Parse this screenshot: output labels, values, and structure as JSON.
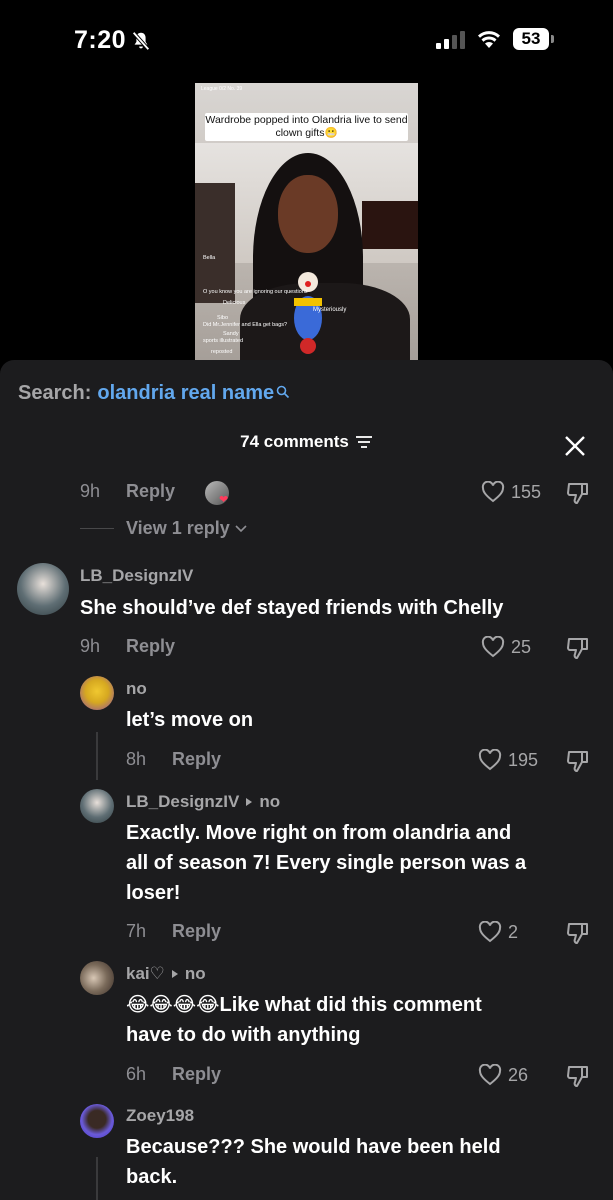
{
  "status": {
    "time": "7:20",
    "battery": "53"
  },
  "video": {
    "caption": "Wardrobe popped into Olandria live to send clown gifts😬",
    "top_text": "League 0/2 No. 39",
    "chat": [
      "Bella",
      "O you know you are ignoring our questions",
      "Delicious",
      "Sibo",
      "Did Mr.Jennifer and Ella get bags?",
      "Sandy",
      "sports illustrated",
      "reposted"
    ],
    "gift_label": "Mysteriously"
  },
  "search": {
    "label": "Search:",
    "query": "olandria real name"
  },
  "header": {
    "count": "74 comments"
  },
  "comments": [
    {
      "id": "c0",
      "time": "9h",
      "reply": "Reply",
      "likes": "155",
      "view_replies": "View 1 reply"
    },
    {
      "id": "c1",
      "user": "LB_DesignzIV",
      "text": "She should’ve def stayed friends with Chelly",
      "time": "9h",
      "reply": "Reply",
      "likes": "25"
    },
    {
      "id": "c2",
      "user": "no",
      "text": "let’s move on",
      "time": "8h",
      "reply": "Reply",
      "likes": "195"
    },
    {
      "id": "c3",
      "user": "LB_DesignzIV",
      "reply_to": "no",
      "text_lines": [
        "Exactly. Move right on from olandria and",
        "all of season 7! Every single person was a",
        "loser!"
      ],
      "time": "7h",
      "reply": "Reply",
      "likes": "2"
    },
    {
      "id": "c4",
      "user": "kai♡",
      "reply_to": "no",
      "text_lines": [
        "😂😂😂😂Like what did this comment",
        "have to do with anything"
      ],
      "time": "6h",
      "reply": "Reply",
      "likes": "26"
    },
    {
      "id": "c5",
      "user": "Zoey198",
      "text_lines": [
        "Because??? She would have been held",
        "back."
      ]
    }
  ]
}
